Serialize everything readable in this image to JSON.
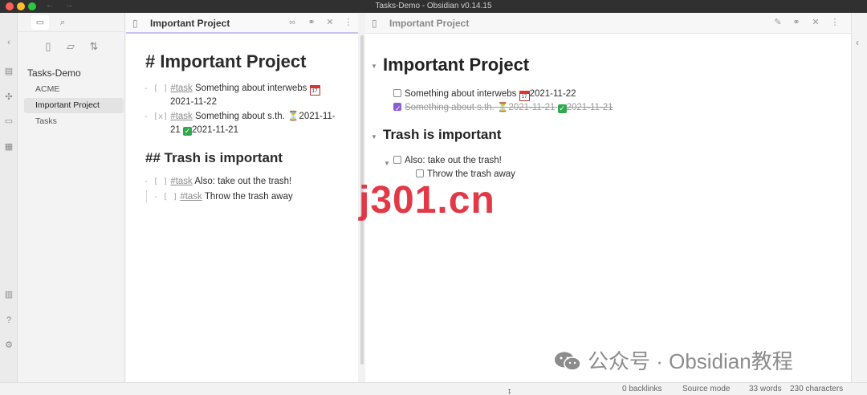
{
  "window": {
    "title": "Tasks-Demo - Obsidian v0.14.15"
  },
  "sidebar": {
    "vault_name": "Tasks-Demo",
    "files": [
      {
        "label": "ACME"
      },
      {
        "label": "Important Project"
      },
      {
        "label": "Tasks"
      }
    ]
  },
  "left_pane": {
    "tab_title": "Important Project",
    "h1": "# Important Project",
    "h2": "## Trash is important",
    "tasks": [
      {
        "marker": "- [ ]",
        "tag": "#task",
        "text": "Something about interwebs",
        "date": "2021-11-22"
      },
      {
        "marker": "- [x]",
        "tag": "#task",
        "text": "Something about s.th.",
        "scheduled": "2021-11-",
        "scheduled_cont": "21",
        "done": "2021-11-21"
      },
      {
        "marker": "- [ ]",
        "tag": "#task",
        "text": "Also: take out the trash!"
      },
      {
        "marker": "- [ ]",
        "tag": "#task",
        "text": "Throw the trash away"
      }
    ]
  },
  "right_pane": {
    "tab_title": "Important Project",
    "h1": "Important Project",
    "h2": "Trash is important",
    "tasks": [
      {
        "text": "Something about interwebs",
        "date": "2021-11-22",
        "checked": false
      },
      {
        "text": "Something about s.th.",
        "scheduled": "2021-11-21",
        "done": "2021-11-21",
        "checked": true
      },
      {
        "text": "Also: take out the trash!",
        "checked": false
      },
      {
        "text": "Throw the trash away",
        "checked": false
      }
    ]
  },
  "watermark": {
    "text": "j301.cn",
    "wechat": "公众号 · Obsidian教程"
  },
  "statusbar": {
    "backlinks": "0 backlinks",
    "mode": "Source mode",
    "words": "33 words",
    "chars": "230 characters"
  },
  "colors": {
    "accent": "#8e5bd6",
    "done_check": "#2fa84f",
    "watermark": "#e12837"
  }
}
